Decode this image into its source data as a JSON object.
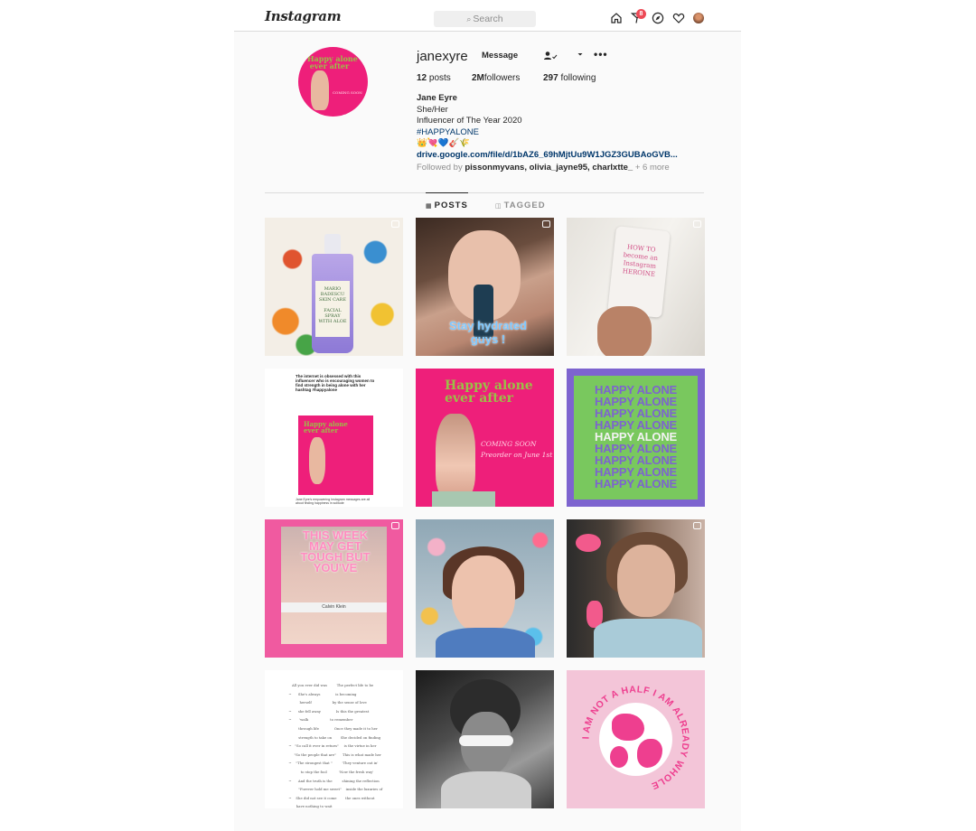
{
  "app": {
    "logo": "Instagram"
  },
  "nav": {
    "search_placeholder": "Search",
    "notifications_badge": "8",
    "icons": [
      "home-icon",
      "direct-inbox-icon",
      "explore-compass-icon",
      "activity-heart-icon",
      "profile-avatar"
    ]
  },
  "profile": {
    "username": "janexyre",
    "message_label": "Message",
    "stats": {
      "posts_count": "12",
      "posts_label": "posts",
      "followers_count": "2M",
      "followers_label": "followers",
      "following_count": "297",
      "following_label": "following"
    },
    "bio": {
      "name": "Jane Eyre",
      "pronouns": "She/Her",
      "line1": "Influencer of The Year 2020",
      "hashtag": "#HAPPYALONE",
      "emojis": "👑💘💙🎸🌾",
      "link": "drive.google.com/file/d/1bAZ6_69hMjtUu9W1JGZ3GUBAoGVB...",
      "followed_by_prefix": "Followed by",
      "followed_by_names": "pissonmyvans, olivia_jayne95, charlxtte_",
      "followed_by_more": "+ 6 more"
    }
  },
  "tabs": {
    "posts": "POSTS",
    "tagged": "TAGGED",
    "active": "posts"
  },
  "posts": [
    {
      "type": "image",
      "caption": ""
    },
    {
      "type": "video",
      "caption": "Stay hydrated guys !"
    },
    {
      "type": "image",
      "caption": "HOW TO become an Instagram HEROINE"
    },
    {
      "type": "image",
      "caption": ""
    },
    {
      "type": "image",
      "caption": "Happy alone ever after"
    },
    {
      "type": "image",
      "caption": "HAPPY ALONE"
    },
    {
      "type": "video",
      "caption": "THIS WEEK MAY GET TOUGH BUT YOU'VE"
    },
    {
      "type": "image",
      "caption": ""
    },
    {
      "type": "video",
      "caption": ""
    },
    {
      "type": "image",
      "caption": ""
    },
    {
      "type": "image",
      "caption": ""
    },
    {
      "type": "image",
      "caption": "I AM NOT A HALF I AM ALREADY WHOLE"
    }
  ],
  "colors": {
    "accent_pink": "#ee1f7a",
    "link_blue": "#00376b",
    "badge_red": "#ed4956"
  }
}
